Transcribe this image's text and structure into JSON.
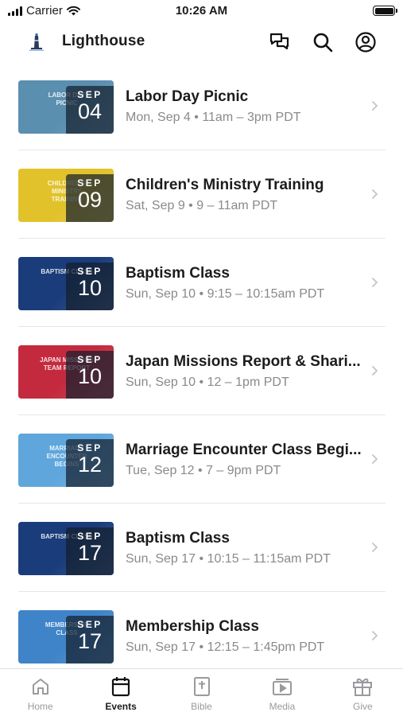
{
  "status_bar": {
    "carrier": "Carrier",
    "time": "10:26 AM"
  },
  "header": {
    "title": "Lighthouse",
    "icons": [
      "lighthouse-logo-icon",
      "chat-icon",
      "search-icon",
      "account-icon"
    ]
  },
  "events": [
    {
      "title": "Labor Day Picnic",
      "subtitle": "Mon, Sep 4 • 11am – 3pm PDT",
      "month": "SEP",
      "day": "04",
      "thumb_text": "LABOR DAY PICNIC",
      "color": "#5a8fb0"
    },
    {
      "title": "Children's Ministry Training",
      "subtitle": "Sat, Sep 9 • 9 – 11am PDT",
      "month": "SEP",
      "day": "09",
      "thumb_text": "CHILDREN'S MINISTRY TRAINING",
      "color": "#e2c22a"
    },
    {
      "title": "Baptism Class",
      "subtitle": "Sun, Sep 10 • 9:15 – 10:15am PDT",
      "month": "SEP",
      "day": "10",
      "thumb_text": "BAPTISM CLASS",
      "color": "#1a3c7a"
    },
    {
      "title": "Japan Missions Report & Shari...",
      "subtitle": "Sun, Sep 10 • 12 – 1pm PDT",
      "month": "SEP",
      "day": "10",
      "thumb_text": "JAPAN MISSIONS TEAM REPORT",
      "color": "#c42a3e"
    },
    {
      "title": "Marriage Encounter Class Begi...",
      "subtitle": "Tue, Sep 12 • 7 – 9pm PDT",
      "month": "SEP",
      "day": "12",
      "thumb_text": "MARRIAGE ENCOUNTER BEGINS",
      "color": "#5fa6dc"
    },
    {
      "title": "Baptism Class",
      "subtitle": "Sun, Sep 17 • 10:15 – 11:15am PDT",
      "month": "SEP",
      "day": "17",
      "thumb_text": "BAPTISM CLASS",
      "color": "#1a3c7a"
    },
    {
      "title": "Membership Class",
      "subtitle": "Sun, Sep 17 • 12:15 – 1:45pm PDT",
      "month": "SEP",
      "day": "17",
      "thumb_text": "MEMBERSHIP CLASS",
      "color": "#3f84c8"
    }
  ],
  "tabs": [
    {
      "label": "Home",
      "icon": "home-icon",
      "active": false
    },
    {
      "label": "Events",
      "icon": "calendar-icon",
      "active": true
    },
    {
      "label": "Bible",
      "icon": "bible-icon",
      "active": false
    },
    {
      "label": "Media",
      "icon": "media-icon",
      "active": false
    },
    {
      "label": "Give",
      "icon": "gift-icon",
      "active": false
    }
  ]
}
